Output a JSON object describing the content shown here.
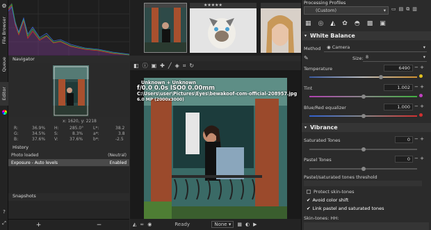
{
  "vtabs": {
    "file_browser": "File Browser",
    "queue": "Queue",
    "editor": "Editor"
  },
  "navigator": {
    "title": "Navigator",
    "coords": "x: 1620, y: 2218",
    "r": "R:",
    "r_val": "36.9%",
    "g": "G:",
    "g_val": "34.5%",
    "b": "B:",
    "b_val": "37.6%",
    "h": "H:",
    "h_val": "285.0°",
    "s": "S:",
    "s_val": "8.3%",
    "v": "V:",
    "v_val": "37.6%",
    "l": "L*:",
    "l_val": "38.2",
    "a": "a*:",
    "a_val": "3.8",
    "bb": "b*:",
    "bb_val": "-2.5"
  },
  "history": {
    "title": "History",
    "items": [
      {
        "label": "Photo loaded",
        "value": "(Neutral)"
      },
      {
        "label": "Exposure - Auto levels",
        "value": "Enabled"
      }
    ]
  },
  "snapshots": {
    "title": "Snapshots"
  },
  "left_bottom": {
    "add": "+",
    "remove": "−"
  },
  "film": {
    "stars": "★★★★★"
  },
  "overlay": {
    "line1": "Unknown + Unknown",
    "line2": "f/0.0  0.0s  ISO0  0.00mm",
    "line3": "C:\\Users\\user\\Pictures\\Eyes\\bewakoof-com-official-208957.jpg",
    "line4": "6.0 MP (2000x3000)"
  },
  "bottom_toolbar": {
    "status": "Ready",
    "none": "None"
  },
  "right": {
    "profiles_title": "Processing Profiles",
    "profile_value": "(Custom)",
    "white_balance": {
      "title": "White Balance",
      "method_label": "Method",
      "method_value": "Camera",
      "size_label": "Size:",
      "size_value": "8",
      "temperature_label": "Temperature",
      "temperature_value": "6490",
      "tint_label": "Tint",
      "tint_value": "1.002",
      "blue_red_label": "Blue/Red equalizer",
      "blue_red_value": "1.000"
    },
    "vibrance": {
      "title": "Vibrance",
      "saturated_label": "Saturated Tones",
      "saturated_value": "0",
      "pastel_label": "Pastel Tones",
      "pastel_value": "0",
      "threshold_label": "Pastel/saturated tones threshold",
      "protect_label": "Protect skin-tones",
      "avoid_label": "Avoid color shift",
      "link_label": "Link pastel and saturated tones",
      "skin_label": "Skin-tones: HH:"
    }
  }
}
